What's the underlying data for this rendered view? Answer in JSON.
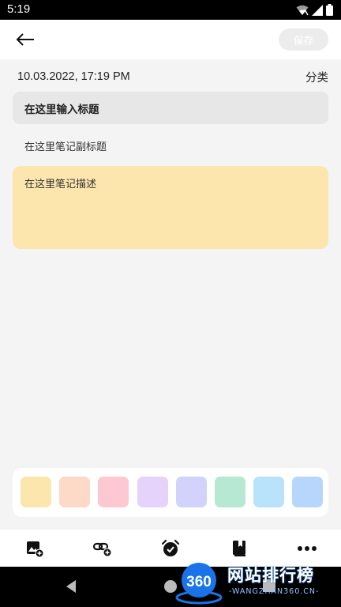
{
  "status_bar": {
    "time": "5:19",
    "icons": [
      "wifi-icon",
      "signal-icon",
      "battery-icon"
    ]
  },
  "app_bar": {
    "back_icon": "arrow-left-icon",
    "save_label": "保存"
  },
  "meta": {
    "datetime": "10.03.2022, 17:19 PM",
    "category_label": "分类"
  },
  "note": {
    "title_placeholder": "在这里输入标题",
    "subtitle_placeholder": "在这里笔记副标题",
    "description_placeholder": "在这里笔记描述",
    "selected_color": "#fde6ad"
  },
  "palette": {
    "colors": [
      "#fde6ad",
      "#fdd9c7",
      "#fec8d2",
      "#e6d3fb",
      "#d2d2fb",
      "#b7e8d3",
      "#b8e3fb",
      "#b7d6fb"
    ]
  },
  "toolbar": {
    "tools": [
      "add-image-icon",
      "add-link-icon",
      "alarm-icon",
      "bookmark-icon",
      "more-icon"
    ]
  },
  "navigation": {
    "buttons": [
      "back-triangle-icon",
      "home-circle-icon",
      "recents-square-icon"
    ]
  },
  "watermark": {
    "badge": "360",
    "brand": "网站排行榜",
    "url": "-WANGZHAN360.CN-"
  }
}
